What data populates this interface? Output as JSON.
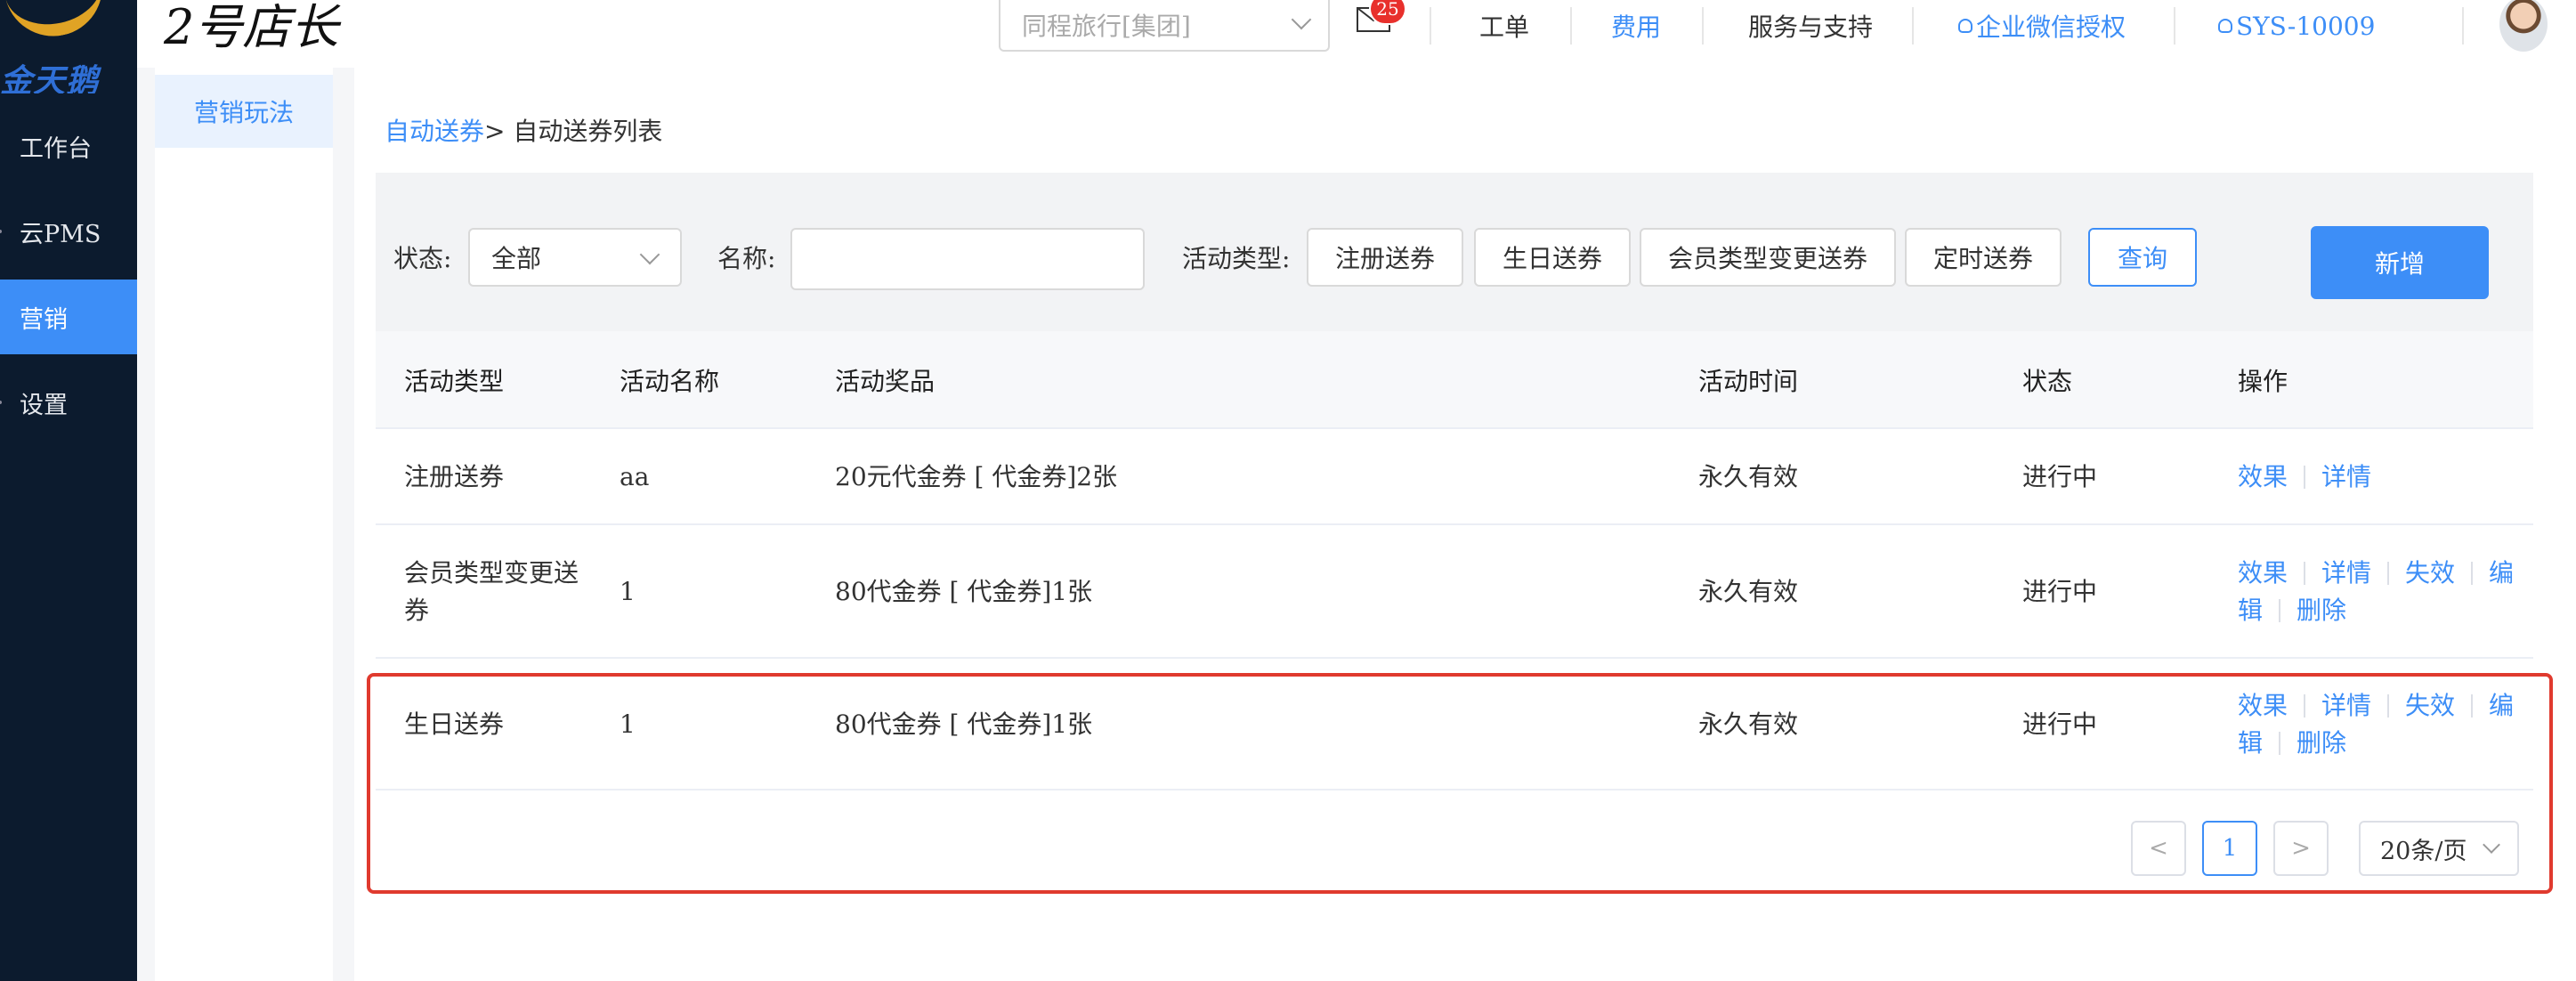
{
  "sidebar": {
    "logo_text": "金天鹅",
    "items": [
      {
        "label": "工作台"
      },
      {
        "label": "云PMS"
      },
      {
        "label": "营销"
      },
      {
        "label": "设置"
      }
    ]
  },
  "header": {
    "brand": "2号店长",
    "org_placeholder": "同程旅行[集团]",
    "mail_count": "25",
    "links": {
      "ticket": "工单",
      "fees": "费用",
      "support": "服务与支持",
      "wechat_auth": "企业微信授权",
      "user": "SYS-10009"
    }
  },
  "submenu": {
    "active": "营销玩法"
  },
  "breadcrumb": {
    "parent": "自动送券",
    "current": "> 自动送券列表"
  },
  "filters": {
    "status_label": "状态:",
    "status_value": "全部",
    "name_label": "名称:",
    "name_value": "",
    "type_label": "活动类型:",
    "type_buttons": [
      "注册送券",
      "生日送券",
      "会员类型变更送券",
      "定时送券"
    ],
    "query_label": "查询",
    "add_label": "新增"
  },
  "table": {
    "columns": [
      "活动类型",
      "活动名称",
      "活动奖品",
      "活动时间",
      "状态",
      "操作"
    ],
    "rows": [
      {
        "type": "注册送券",
        "name": "aa",
        "prize": "20元代金券 [ 代金券]2张",
        "time": "永久有效",
        "status": "进行中",
        "ops_line1": [
          "效果",
          "详情"
        ],
        "ops_line2": []
      },
      {
        "type": "会员类型变更送券",
        "name": "1",
        "prize": "80代金券 [ 代金券]1张",
        "time": "永久有效",
        "status": "进行中",
        "ops_line1": [
          "效果",
          "详情",
          "失效",
          "编"
        ],
        "ops_line2": [
          "辑",
          "删除"
        ]
      },
      {
        "type": "生日送券",
        "name": "1",
        "prize": "80代金券 [ 代金券]1张",
        "time": "永久有效",
        "status": "进行中",
        "ops_line1": [
          "效果",
          "详情",
          "失效",
          "编"
        ],
        "ops_line2": [
          "辑",
          "删除"
        ]
      }
    ]
  },
  "pagination": {
    "prev": "<",
    "current_page": "1",
    "next": ">",
    "page_size": "20条/页"
  },
  "colors": {
    "accent": "#3d8ef7",
    "sidebar_bg": "#0c1b2e",
    "highlight_border": "#e03a2e",
    "badge": "#e8302c"
  }
}
